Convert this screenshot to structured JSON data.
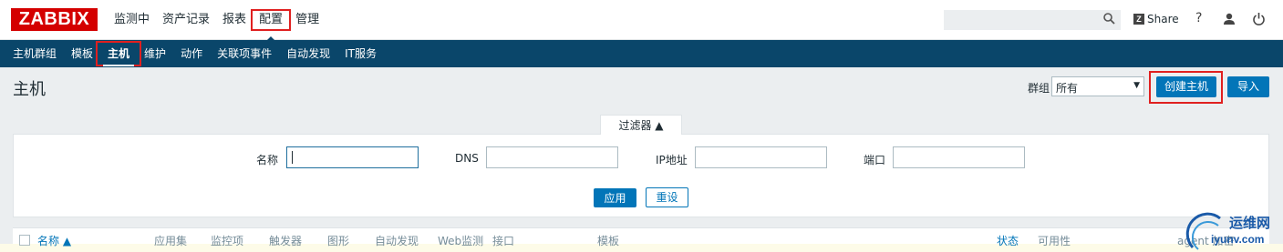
{
  "brand": {
    "logo": "ZABBIX"
  },
  "main_nav": [
    {
      "label": "监测中"
    },
    {
      "label": "资产记录"
    },
    {
      "label": "报表"
    },
    {
      "label": "配置"
    },
    {
      "label": "管理"
    }
  ],
  "top_right": {
    "share_label": "Share",
    "help_label": "?"
  },
  "sub_nav": [
    {
      "label": "主机群组"
    },
    {
      "label": "模板"
    },
    {
      "label": "主机"
    },
    {
      "label": "维护"
    },
    {
      "label": "动作"
    },
    {
      "label": "关联项事件"
    },
    {
      "label": "自动发现"
    },
    {
      "label": "IT服务"
    }
  ],
  "page": {
    "title": "主机",
    "group_label": "群组",
    "group_value": "所有",
    "create_button": "创建主机",
    "import_button": "导入"
  },
  "filter": {
    "tab_label": "过滤器 ▲",
    "name_label": "名称",
    "dns_label": "DNS",
    "ip_label": "IP地址",
    "port_label": "端口",
    "name_value": "",
    "dns_value": "",
    "ip_value": "",
    "port_value": "",
    "apply_button": "应用",
    "reset_button": "重设"
  },
  "table": {
    "columns": [
      "名称 ▲",
      "应用集",
      "监控项",
      "触发器",
      "图形",
      "自动发现",
      "Web监测",
      "接口",
      "模板",
      "状态",
      "可用性",
      "agent 加密"
    ]
  },
  "watermark": {
    "top": "运维网",
    "bottom": "iyunv.com"
  },
  "colors": {
    "brand_red": "#d40000",
    "nav_blue": "#0a466a",
    "button_blue": "#0275b8",
    "highlight_red": "#e02020"
  }
}
